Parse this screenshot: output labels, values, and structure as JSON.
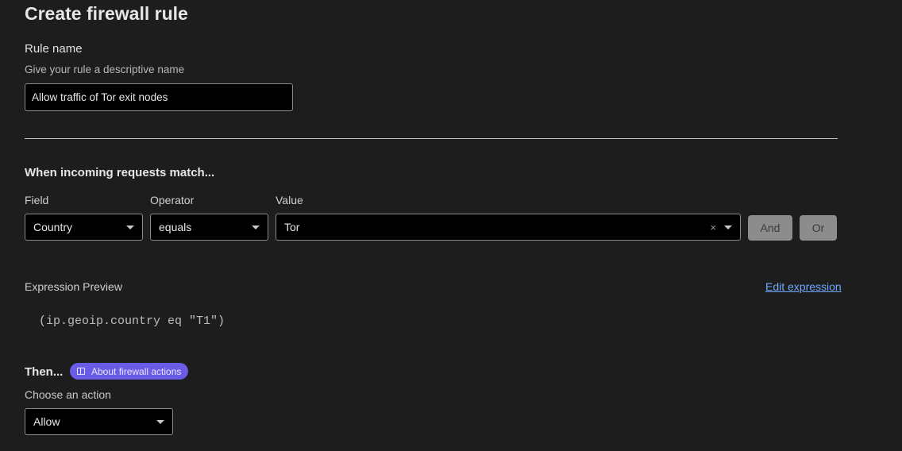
{
  "page": {
    "title": "Create firewall rule"
  },
  "rule_name": {
    "label": "Rule name",
    "helper": "Give your rule a descriptive name",
    "value": "Allow traffic of Tor exit nodes"
  },
  "match": {
    "heading": "When incoming requests match...",
    "field_label": "Field",
    "operator_label": "Operator",
    "value_label": "Value",
    "field_value": "Country",
    "operator_value": "equals",
    "value_value": "Tor",
    "clear_symbol": "×",
    "and_label": "And",
    "or_label": "Or"
  },
  "expression": {
    "label": "Expression Preview",
    "edit_link": "Edit expression",
    "preview": "(ip.geoip.country eq \"T1\")"
  },
  "action": {
    "heading": "Then...",
    "badge": "About firewall actions",
    "helper": "Choose an action",
    "value": "Allow"
  },
  "icons": {
    "caret": "chevron-down-icon",
    "clear": "clear-icon",
    "book": "book-icon"
  },
  "colors": {
    "background": "#1d1d1d",
    "link": "#6ea8ff",
    "badge": "#6b5ce7",
    "button_disabled": "#8c8c8c"
  }
}
